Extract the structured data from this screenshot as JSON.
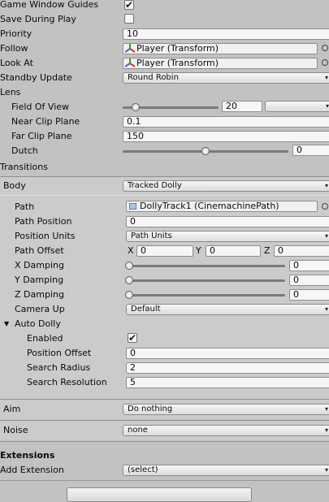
{
  "game_window_guides": {
    "label": "Game Window Guides",
    "checked": true
  },
  "save_during_play": {
    "label": "Save During Play",
    "checked": false
  },
  "priority": {
    "label": "Priority",
    "value": "10"
  },
  "follow": {
    "label": "Follow",
    "value": "Player (Transform)"
  },
  "look_at": {
    "label": "Look At",
    "value": "Player (Transform)"
  },
  "standby_update": {
    "label": "Standby Update",
    "value": "Round Robin"
  },
  "lens": {
    "label": "Lens",
    "fov": {
      "label": "Field Of View",
      "value": "20"
    },
    "near": {
      "label": "Near Clip Plane",
      "value": "0.1"
    },
    "far": {
      "label": "Far Clip Plane",
      "value": "150"
    },
    "dutch": {
      "label": "Dutch",
      "value": "0"
    }
  },
  "transitions": {
    "label": "Transitions"
  },
  "body": {
    "label": "Body",
    "value": "Tracked Dolly",
    "path": {
      "label": "Path",
      "value": "DollyTrack1 (CinemachinePath)"
    },
    "path_position": {
      "label": "Path Position",
      "value": "0"
    },
    "position_units": {
      "label": "Position Units",
      "value": "Path Units"
    },
    "path_offset": {
      "label": "Path Offset",
      "x_label": "X",
      "x": "0",
      "y_label": "Y",
      "y": "0",
      "z_label": "Z",
      "z": "0"
    },
    "x_damping": {
      "label": "X Damping",
      "value": "0"
    },
    "y_damping": {
      "label": "Y Damping",
      "value": "0"
    },
    "z_damping": {
      "label": "Z Damping",
      "value": "0"
    },
    "camera_up": {
      "label": "Camera Up",
      "value": "Default"
    },
    "auto_dolly": {
      "label": "Auto Dolly",
      "enabled": {
        "label": "Enabled",
        "checked": true
      },
      "position_offset": {
        "label": "Position Offset",
        "value": "0"
      },
      "search_radius": {
        "label": "Search Radius",
        "value": "2"
      },
      "search_resolution": {
        "label": "Search Resolution",
        "value": "5"
      }
    }
  },
  "aim": {
    "label": "Aim",
    "value": "Do nothing"
  },
  "noise": {
    "label": "Noise",
    "value": "none"
  },
  "extensions": {
    "label": "Extensions",
    "add_label": "Add Extension",
    "add_value": "(select)"
  },
  "checkmark": "✔",
  "arrow": "▾",
  "collapse_arrow": "▼"
}
